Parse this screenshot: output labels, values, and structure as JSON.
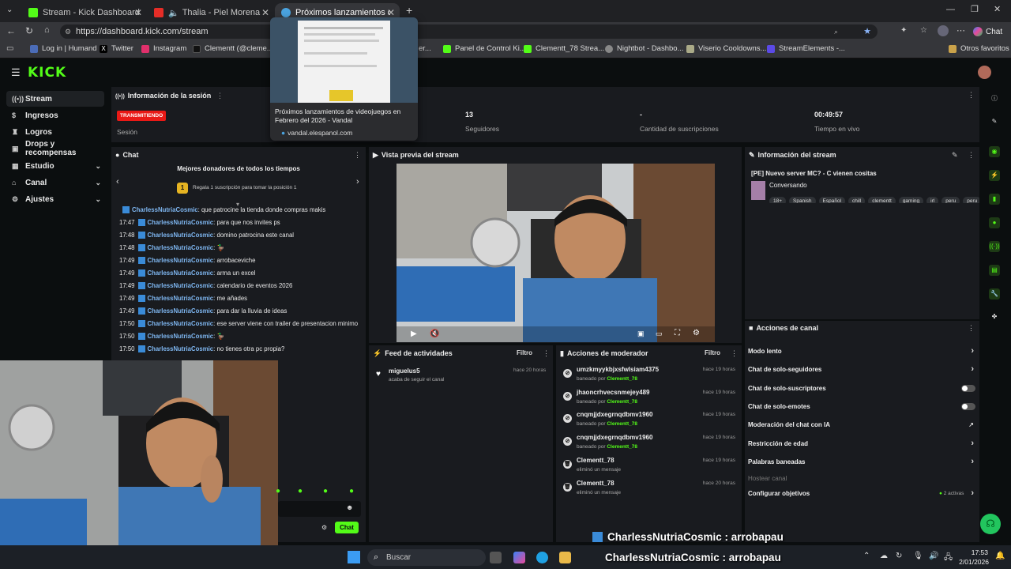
{
  "browser": {
    "tabs": [
      {
        "title": "Stream - Kick Dashboard"
      },
      {
        "title": "Thalia - Piel Morena - Video C"
      },
      {
        "title": "Próximos lanzamientos de videoju"
      }
    ],
    "url": "https://dashboard.kick.com/stream",
    "chat_button": "Chat",
    "bookmarks": [
      "Log in | Humand",
      "Twitter",
      "Instagram",
      "Clementt (@cleme...",
      "er...",
      "Panel de Control Ki...",
      "Clementt_78 Strea...",
      "Nightbot - Dashbo...",
      "Viserio Cooldowns...",
      "StreamElements -...",
      "Otros favoritos"
    ],
    "tab_preview": {
      "title": "Próximos lanzamientos de videojuegos en Febrero del 2026 - Vandal",
      "domain": "vandal.elespanol.com"
    }
  },
  "kick": {
    "logo": "KICK",
    "nav": [
      {
        "label": "Stream",
        "icon": "stream-icon"
      },
      {
        "label": "Ingresos",
        "icon": "dollar-icon"
      },
      {
        "label": "Logros",
        "icon": "trophy-icon"
      },
      {
        "label": "Drops y recompensas",
        "icon": "gift-icon"
      },
      {
        "label": "Estudio",
        "icon": "studio-icon"
      },
      {
        "label": "Canal",
        "icon": "home-icon"
      },
      {
        "label": "Ajustes",
        "icon": "gear-icon"
      }
    ],
    "session": {
      "header": "Información de la sesión",
      "status": "TRANSMITIENDO",
      "status_label": "Sesión",
      "followers_value": "13",
      "followers_label": "Seguidores",
      "subs_value": "-",
      "subs_label": "Cantidad de suscripciones",
      "live_value": "00:49:57",
      "live_label": "Tiempo en vivo"
    },
    "chat": {
      "header": "Chat",
      "donors_title": "Mejores donadores de todos los tiempos",
      "donors_cta": "Regala 1 suscripción para tomar la posición 1",
      "rank": "1",
      "messages": [
        {
          "time": "",
          "user": "CharlessNutriaCosmic",
          "text": ": que patrocine la tienda donde compras makis"
        },
        {
          "time": "17:47",
          "user": "CharlessNutriaCosmic",
          "text": ": para que nos invites ps"
        },
        {
          "time": "17:48",
          "user": "CharlessNutriaCosmic",
          "text": ": domino patrocina este canal"
        },
        {
          "time": "17:48",
          "user": "CharlessNutriaCosmic",
          "text": ": 🦆"
        },
        {
          "time": "17:49",
          "user": "CharlessNutriaCosmic",
          "text": ": arrobaceviche"
        },
        {
          "time": "17:49",
          "user": "CharlessNutriaCosmic",
          "text": ": arma un excel"
        },
        {
          "time": "17:49",
          "user": "CharlessNutriaCosmic",
          "text": ": calendario de eventos 2026"
        },
        {
          "time": "17:49",
          "user": "CharlessNutriaCosmic",
          "text": ": me añades"
        },
        {
          "time": "17:49",
          "user": "CharlessNutriaCosmic",
          "text": ": para dar la lluvia de ideas"
        },
        {
          "time": "17:50",
          "user": "CharlessNutriaCosmic",
          "text": ": ese server viene con trailer de presentacion minimo"
        },
        {
          "time": "17:50",
          "user": "CharlessNutriaCosmic",
          "text": ": 🦆"
        },
        {
          "time": "17:50",
          "user": "CharlessNutriaCosmic",
          "text": ": no tienes otra pc propia?"
        }
      ],
      "send_label": "Chat"
    },
    "preview": {
      "header": "Vista previa del stream"
    },
    "feed": {
      "header": "Feed de actividades",
      "filter": "Filtro",
      "items": [
        {
          "user": "miguelus5",
          "action": "acaba de seguir el canal",
          "time": "hace 20 horas"
        }
      ]
    },
    "mod": {
      "header": "Acciones de moderador",
      "filter": "Filtro",
      "items": [
        {
          "user": "umzkmyykbjxsfwlsiam4375",
          "action": "baneado por",
          "by": "Clementt_78",
          "time": "hace 19 horas",
          "icon": "ban-icon"
        },
        {
          "user": "jhaoncrhvecsnmejey489",
          "action": "baneado por",
          "by": "Clementt_78",
          "time": "hace 19 horas",
          "icon": "ban-icon"
        },
        {
          "user": "cnqmjjdxegrnqdbmv1960",
          "action": "baneado por",
          "by": "Clementt_78",
          "time": "hace 19 horas",
          "icon": "ban-icon"
        },
        {
          "user": "cnqmjjdxegrnqdbmv1960",
          "action": "baneado por",
          "by": "Clementt_78",
          "time": "hace 19 horas",
          "icon": "ban-icon"
        },
        {
          "user": "Clementt_78",
          "action": "eliminó un mensaje",
          "by": "",
          "time": "hace 19 horas",
          "icon": "trash-icon"
        },
        {
          "user": "Clementt_78",
          "action": "eliminó un mensaje",
          "by": "",
          "time": "hace 20 horas",
          "icon": "trash-icon"
        }
      ]
    },
    "info": {
      "header": "Información del stream",
      "title": "[PE] Nuevo server MC? - C vienen cositas",
      "category": "Conversando",
      "tags": [
        "18+",
        "Spanish",
        "Español",
        "chill",
        "clementt",
        "gaming",
        "irl",
        "peru",
        "peru"
      ]
    },
    "actions": {
      "header": "Acciones de canal",
      "items": [
        {
          "label": "Modo lento",
          "control": "arrow"
        },
        {
          "label": "Chat de solo-seguidores",
          "control": "arrow"
        },
        {
          "label": "Chat de solo-suscriptores",
          "control": "toggle"
        },
        {
          "label": "Chat de solo-emotes",
          "control": "toggle"
        },
        {
          "label": "Moderación del chat con IA",
          "control": "external"
        },
        {
          "label": "Restricción de edad",
          "control": "arrow"
        },
        {
          "label": "Palabras baneadas",
          "control": "arrow"
        },
        {
          "label": "Hostear canal",
          "control": "none"
        },
        {
          "label": "Configurar objetivos",
          "control": "arrow"
        }
      ],
      "active_count": "2 activas"
    }
  },
  "overlay": {
    "text": "CharlessNutriaCosmic : arrobapau"
  },
  "taskbar": {
    "search": "Buscar",
    "time": "17:53",
    "date": "2/01/2026"
  },
  "colors": {
    "kick_green": "#53fc18",
    "live_red": "#e91916"
  }
}
